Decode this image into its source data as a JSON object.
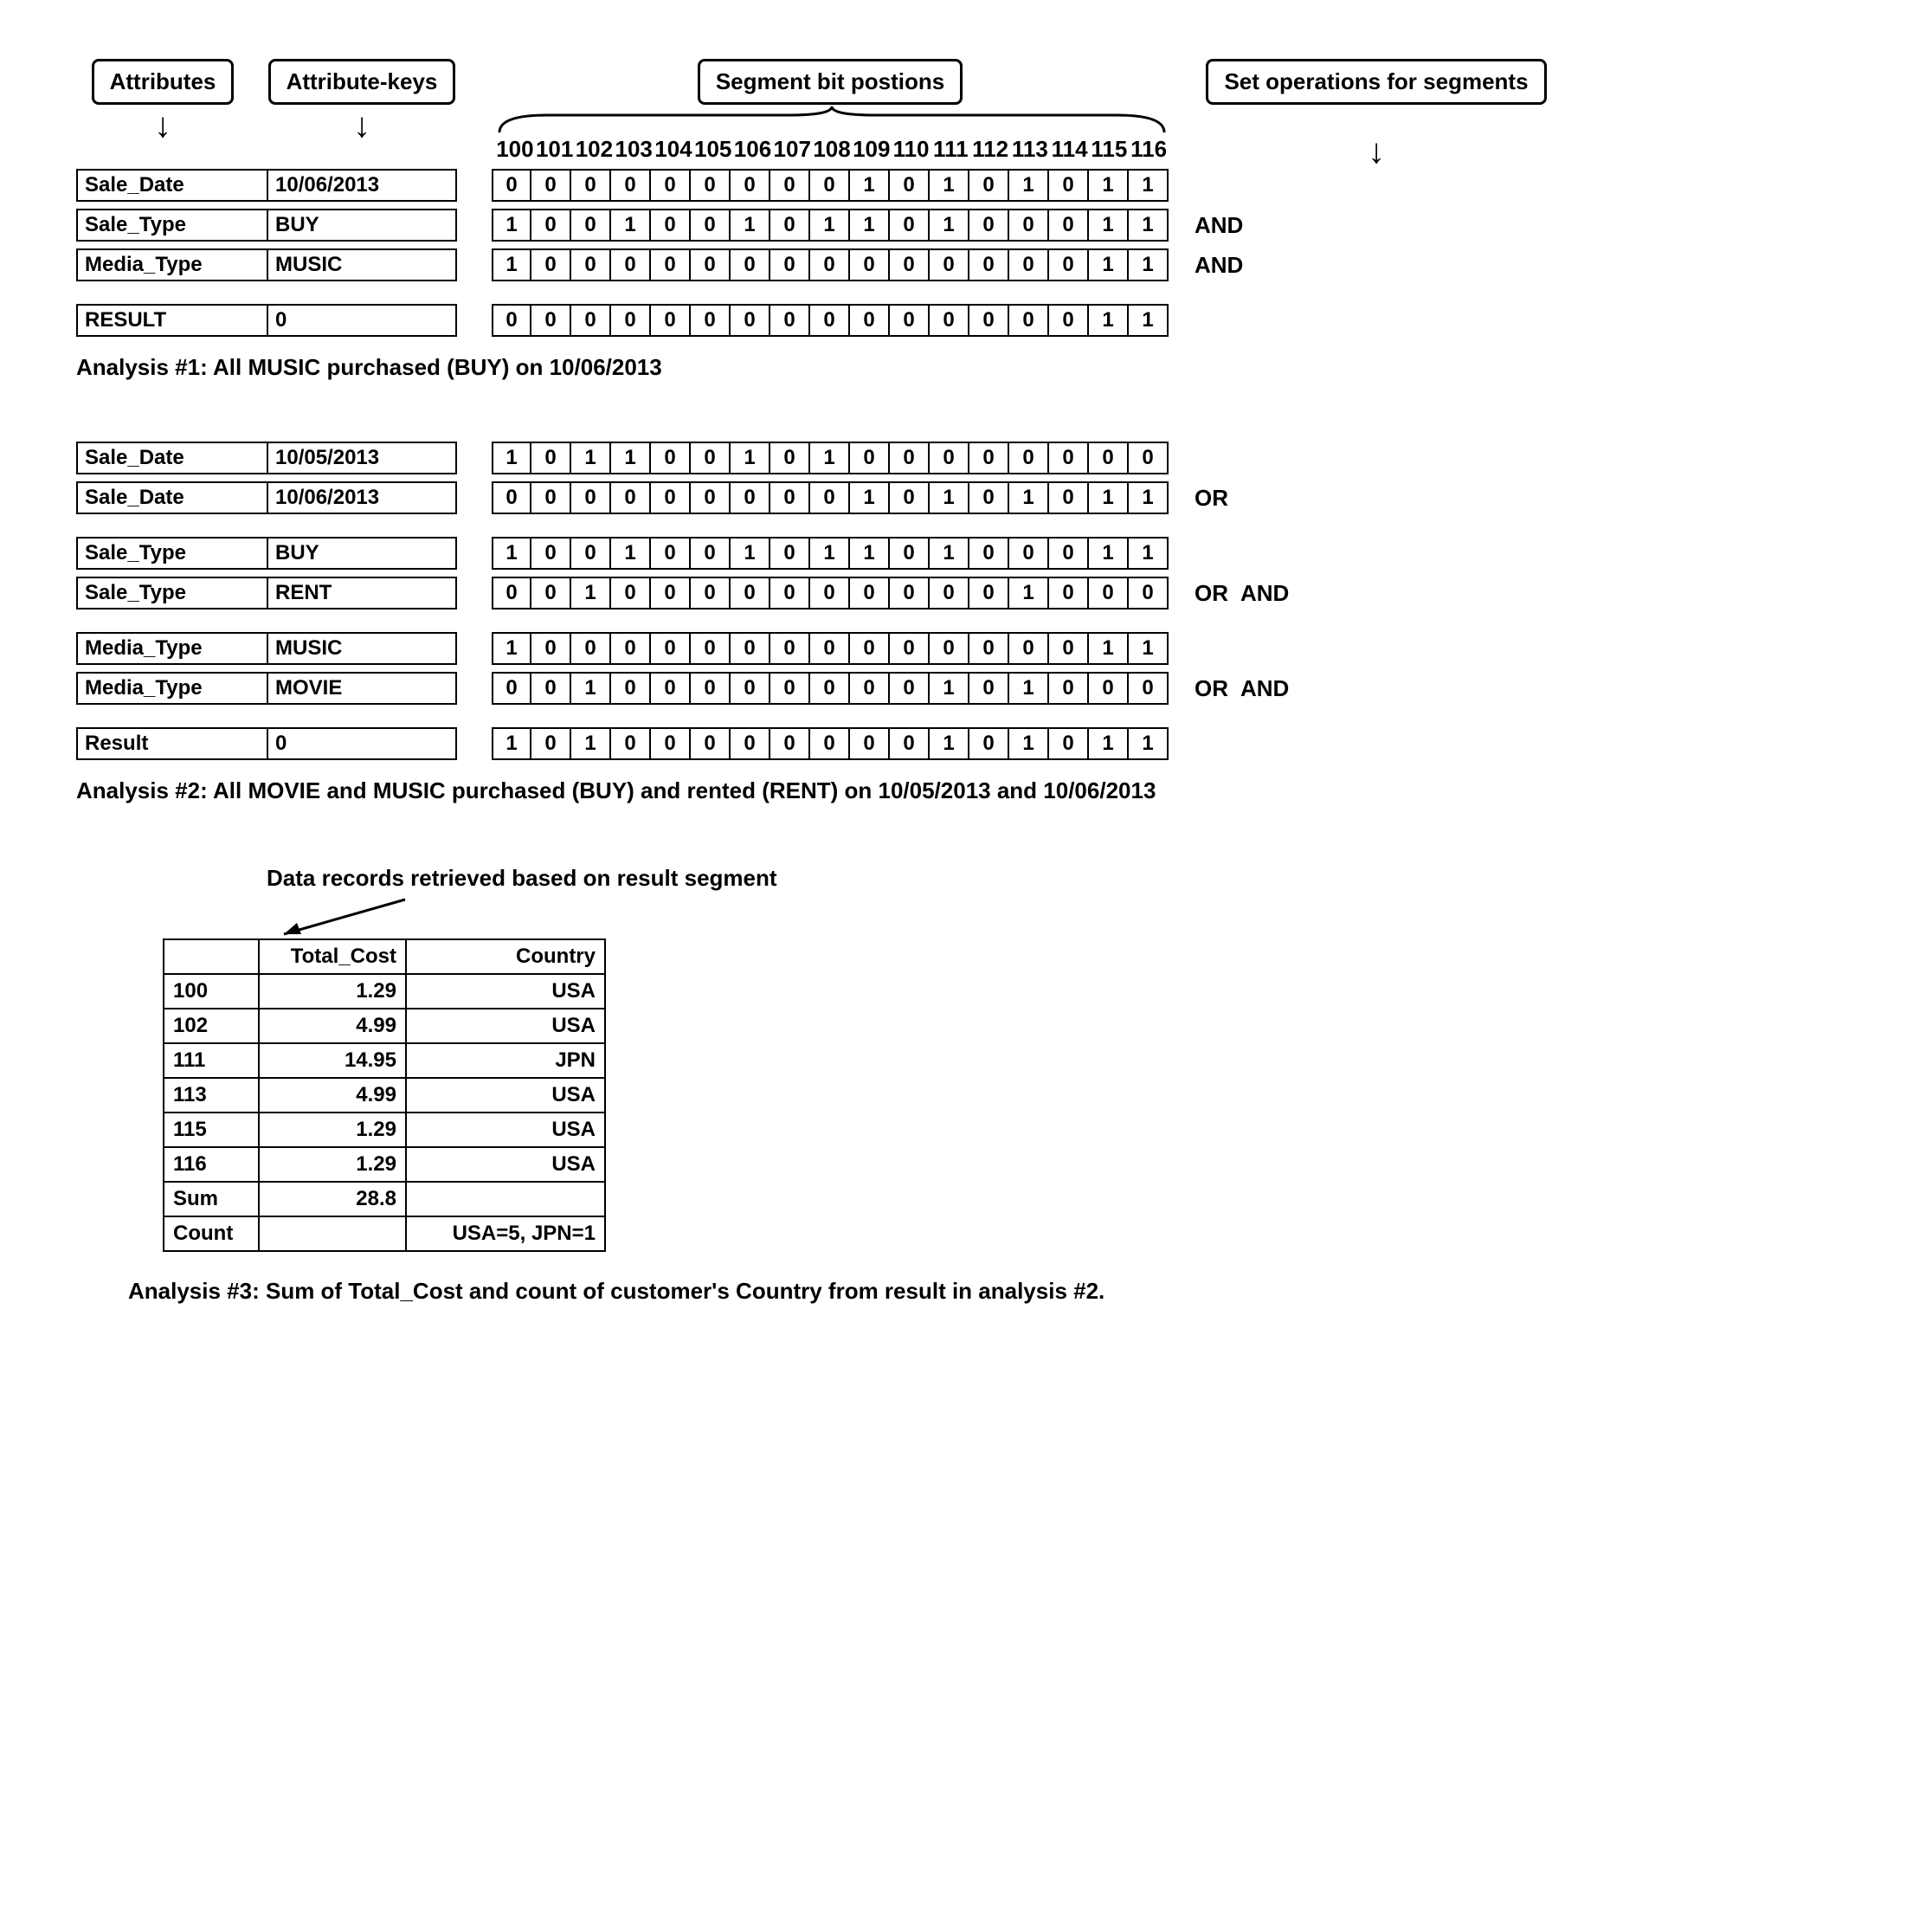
{
  "labels": {
    "attributes": "Attributes",
    "attribute_keys": "Attribute-keys",
    "segment_bits": "Segment bit postions",
    "set_ops": "Set operations for segments"
  },
  "positions": [
    "100",
    "101",
    "102",
    "103",
    "104",
    "105",
    "106",
    "107",
    "108",
    "109",
    "110",
    "111",
    "112",
    "113",
    "114",
    "115",
    "116"
  ],
  "analysis1": {
    "caption": "Analysis #1:    All MUSIC purchased (BUY) on 10/06/2013",
    "rows": [
      {
        "attr": "Sale_Date",
        "key": "10/06/2013",
        "bits": [
          0,
          0,
          0,
          0,
          0,
          0,
          0,
          0,
          0,
          1,
          0,
          1,
          0,
          1,
          0,
          1,
          1
        ],
        "ops": []
      },
      {
        "attr": "Sale_Type",
        "key": "BUY",
        "bits": [
          1,
          0,
          0,
          1,
          0,
          0,
          1,
          0,
          1,
          1,
          0,
          1,
          0,
          0,
          0,
          1,
          1
        ],
        "ops": [
          "AND"
        ]
      },
      {
        "attr": "Media_Type",
        "key": "MUSIC",
        "bits": [
          1,
          0,
          0,
          0,
          0,
          0,
          0,
          0,
          0,
          0,
          0,
          0,
          0,
          0,
          0,
          1,
          1
        ],
        "ops": [
          "AND"
        ]
      }
    ],
    "result": {
      "attr": "RESULT",
      "key": "0",
      "bits": [
        0,
        0,
        0,
        0,
        0,
        0,
        0,
        0,
        0,
        0,
        0,
        0,
        0,
        0,
        0,
        1,
        1
      ],
      "ops": []
    }
  },
  "analysis2": {
    "caption": "Analysis #2:    All MOVIE and MUSIC purchased (BUY) and rented (RENT) on 10/05/2013 and 10/06/2013",
    "groups": [
      [
        {
          "attr": "Sale_Date",
          "key": "10/05/2013",
          "bits": [
            1,
            0,
            1,
            1,
            0,
            0,
            1,
            0,
            1,
            0,
            0,
            0,
            0,
            0,
            0,
            0,
            0
          ],
          "ops": []
        },
        {
          "attr": "Sale_Date",
          "key": "10/06/2013",
          "bits": [
            0,
            0,
            0,
            0,
            0,
            0,
            0,
            0,
            0,
            1,
            0,
            1,
            0,
            1,
            0,
            1,
            1
          ],
          "ops": [
            "OR"
          ]
        }
      ],
      [
        {
          "attr": "Sale_Type",
          "key": "BUY",
          "bits": [
            1,
            0,
            0,
            1,
            0,
            0,
            1,
            0,
            1,
            1,
            0,
            1,
            0,
            0,
            0,
            1,
            1
          ],
          "ops": []
        },
        {
          "attr": "Sale_Type",
          "key": "RENT",
          "bits": [
            0,
            0,
            1,
            0,
            0,
            0,
            0,
            0,
            0,
            0,
            0,
            0,
            0,
            1,
            0,
            0,
            0
          ],
          "ops": [
            "OR",
            "AND"
          ]
        }
      ],
      [
        {
          "attr": "Media_Type",
          "key": "MUSIC",
          "bits": [
            1,
            0,
            0,
            0,
            0,
            0,
            0,
            0,
            0,
            0,
            0,
            0,
            0,
            0,
            0,
            1,
            1
          ],
          "ops": []
        },
        {
          "attr": "Media_Type",
          "key": "MOVIE",
          "bits": [
            0,
            0,
            1,
            0,
            0,
            0,
            0,
            0,
            0,
            0,
            0,
            1,
            0,
            1,
            0,
            0,
            0
          ],
          "ops": [
            "OR",
            "AND"
          ]
        }
      ]
    ],
    "result": {
      "attr": "Result",
      "key": "0",
      "bits": [
        1,
        0,
        1,
        0,
        0,
        0,
        0,
        0,
        0,
        0,
        0,
        1,
        0,
        1,
        0,
        1,
        1
      ],
      "ops": []
    }
  },
  "analysis3": {
    "note": "Data records retrieved based on result segment",
    "headers": [
      "",
      "Total_Cost",
      "Country"
    ],
    "rows": [
      {
        "id": "100",
        "cost": "1.29",
        "country": "USA"
      },
      {
        "id": "102",
        "cost": "4.99",
        "country": "USA"
      },
      {
        "id": "111",
        "cost": "14.95",
        "country": "JPN"
      },
      {
        "id": "113",
        "cost": "4.99",
        "country": "USA"
      },
      {
        "id": "115",
        "cost": "1.29",
        "country": "USA"
      },
      {
        "id": "116",
        "cost": "1.29",
        "country": "USA"
      }
    ],
    "sum_label": "Sum",
    "sum": "28.8",
    "count_label": "Count",
    "count": "USA=5, JPN=1",
    "caption": "Analysis #3: Sum of Total_Cost and count of customer's Country from result in analysis #2."
  }
}
